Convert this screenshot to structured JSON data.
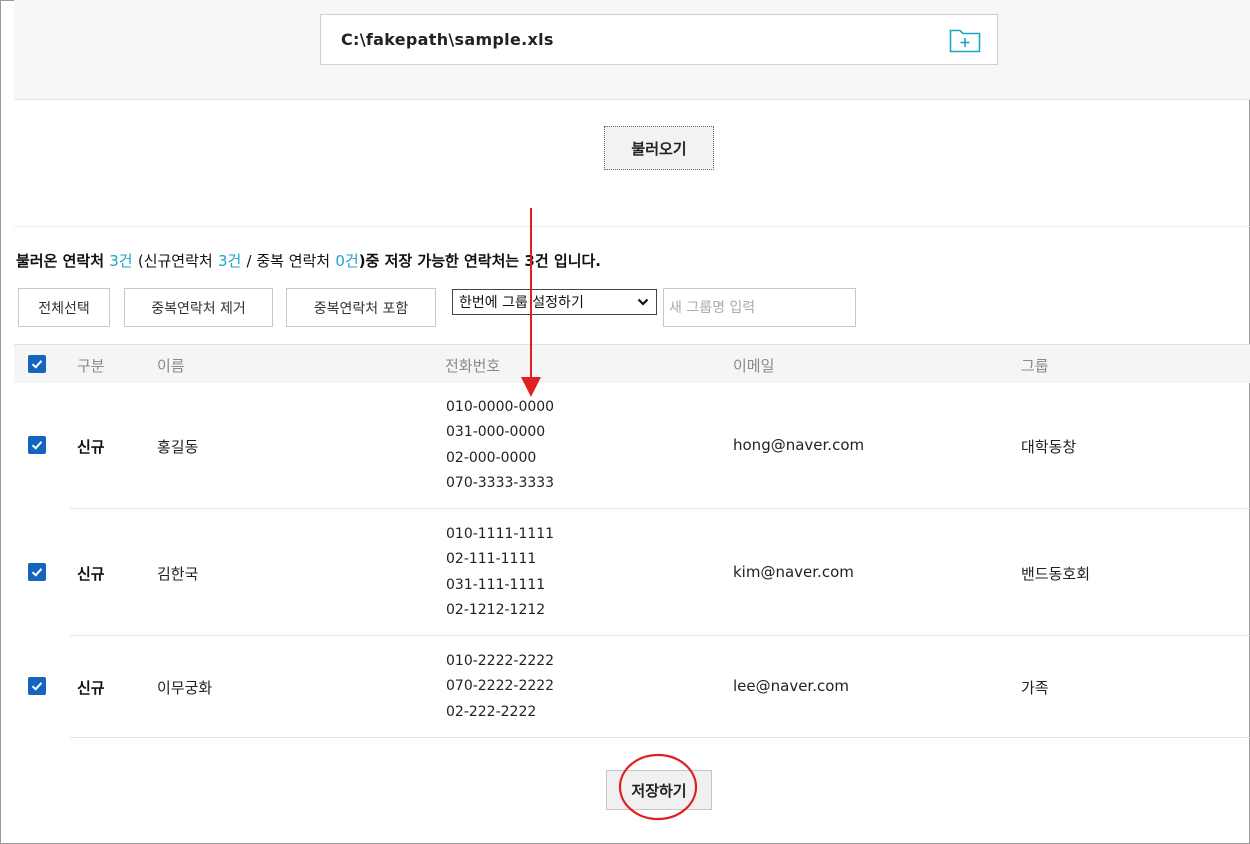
{
  "file": {
    "path": "C:\\fakepath\\sample.xls",
    "icon": "folder-plus-icon",
    "icon_color": "#1ba6c6"
  },
  "load_button": "불러오기",
  "summary": {
    "p1": "불러온 연락처",
    "total": "3건",
    "p2": "(신규연락처",
    "new_count": "3건",
    "p3": "/ 중복 연락처",
    "dup_count": "0건",
    "p4": ")중 저장 가능한 연락처는 3건 입니다.",
    "accent_color": "#1ba6c6"
  },
  "toolbar": {
    "select_all": "전체선택",
    "remove_dup": "중복연락처 제거",
    "include_dup": "중복연락처 포함",
    "group_select": "한번에 그룹 설정하기",
    "group_input_placeholder": "새 그룹명 입력"
  },
  "table": {
    "headers": {
      "type": "구분",
      "name": "이름",
      "phone": "전화번호",
      "email": "이메일",
      "group": "그룹"
    },
    "rows": [
      {
        "checked": true,
        "type": "신규",
        "name": "홍길동",
        "phones": [
          "010-0000-0000",
          "031-000-0000",
          "02-000-0000",
          "070-3333-3333"
        ],
        "email": "hong@naver.com",
        "group": "대학동창"
      },
      {
        "checked": true,
        "type": "신규",
        "name": "김한국",
        "phones": [
          "010-1111-1111",
          "02-111-1111",
          "031-111-1111",
          "02-1212-1212"
        ],
        "email": "kim@naver.com",
        "group": "밴드동호회"
      },
      {
        "checked": true,
        "type": "신규",
        "name": "이무궁화",
        "phones": [
          "010-2222-2222",
          "070-2222-2222",
          "02-222-2222"
        ],
        "email": "lee@naver.com",
        "group": "가족"
      }
    ]
  },
  "save_button": "저장하기",
  "colors": {
    "checkbox": "#1565c0",
    "annotation": "#e02020"
  }
}
